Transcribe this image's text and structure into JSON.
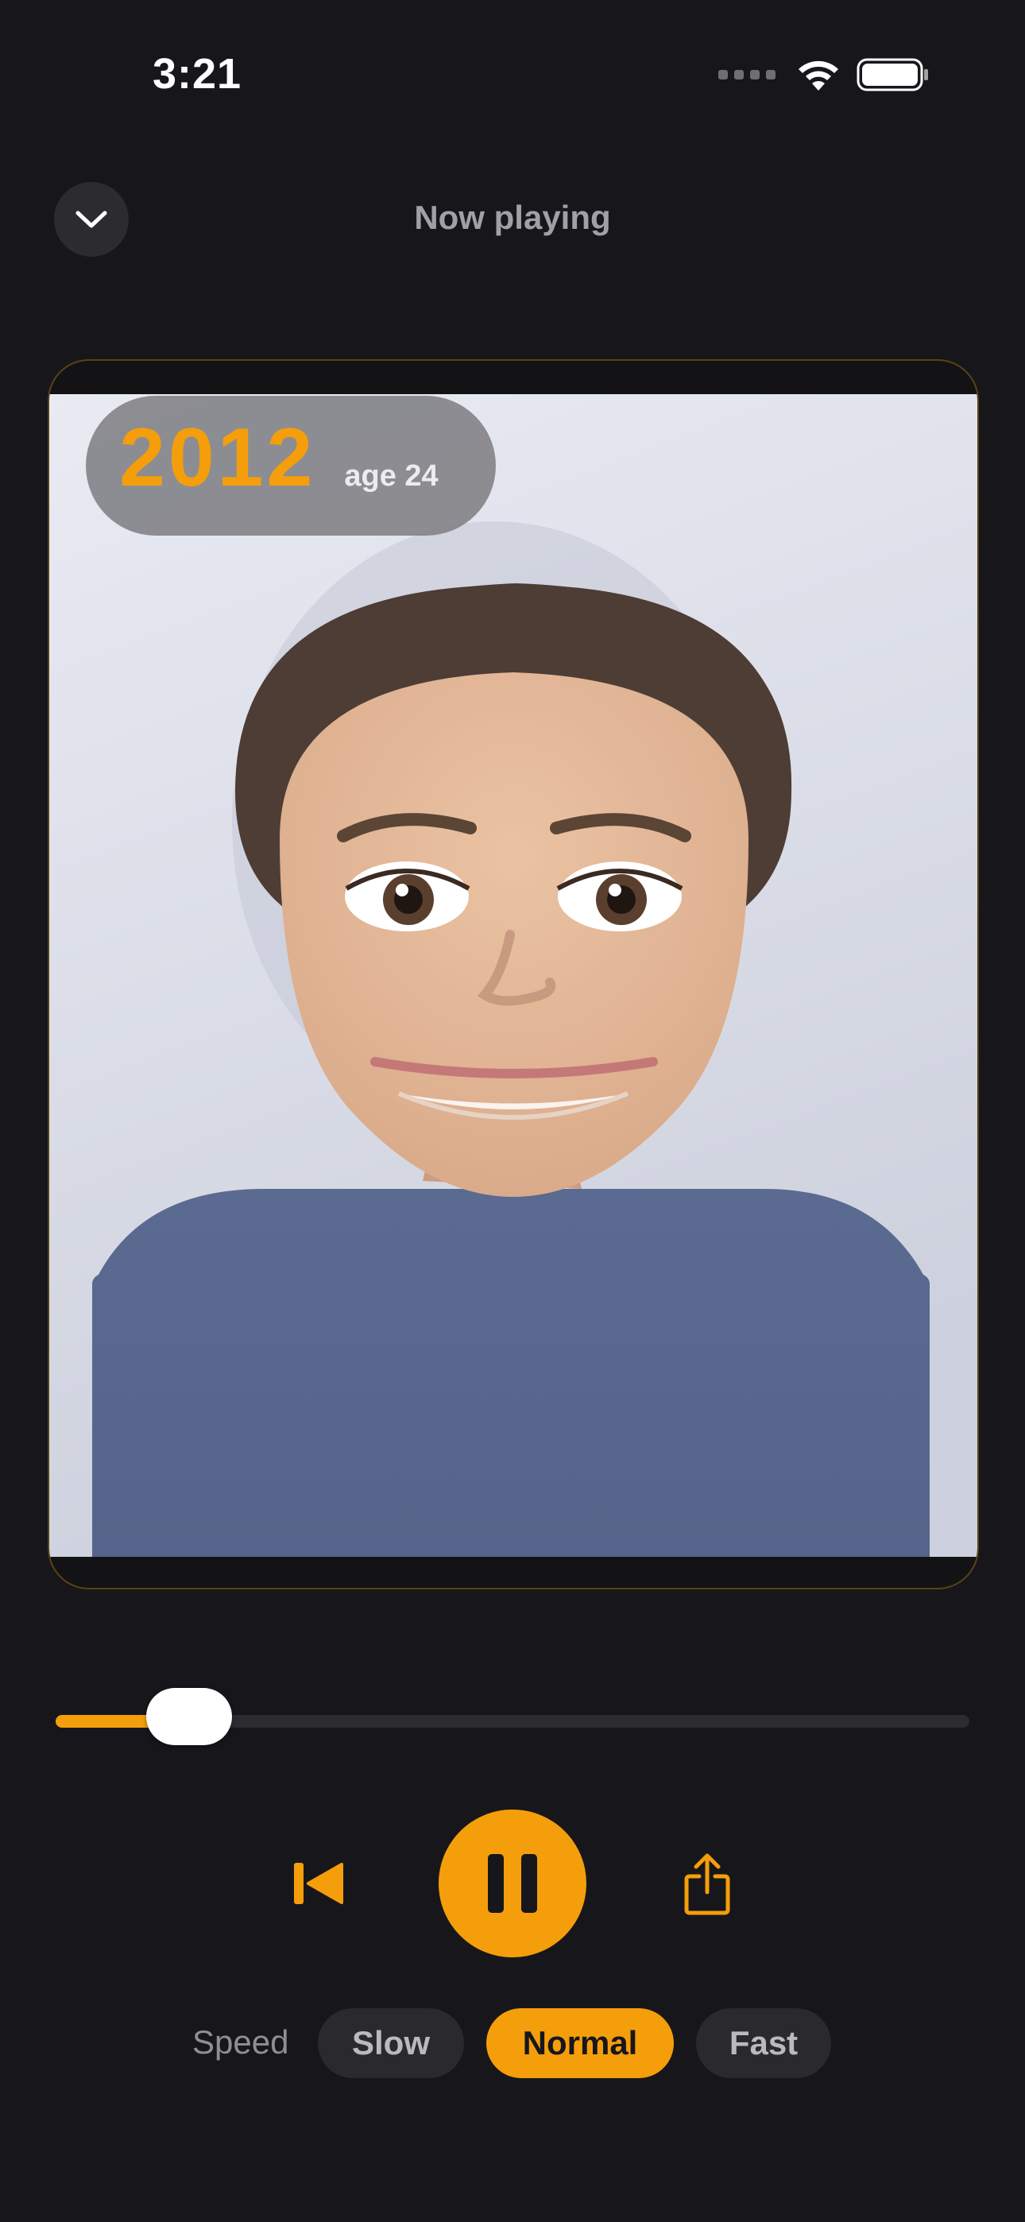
{
  "status_bar": {
    "time": "3:21"
  },
  "header": {
    "title": "Now playing",
    "collapse_icon": "chevron-down-icon"
  },
  "media": {
    "year": "2012",
    "age": "age 24"
  },
  "playback": {
    "progress_fraction": 0.146
  },
  "controls": {
    "rewind_icon": "skip-back-icon",
    "pause_icon": "pause-icon",
    "share_icon": "share-icon"
  },
  "speed": {
    "label": "Speed",
    "options": [
      "Slow",
      "Normal",
      "Fast"
    ],
    "selected": "Normal"
  },
  "colors": {
    "accent": "#f59e0b",
    "background": "#17171b",
    "pill_background": "#2a2a2e"
  }
}
